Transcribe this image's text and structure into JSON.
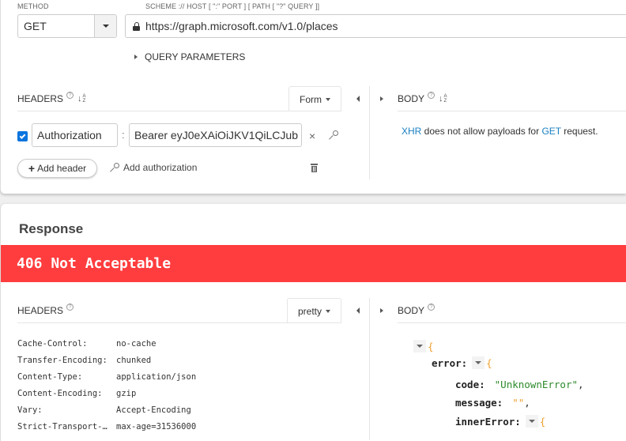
{
  "request": {
    "method_label": "METHOD",
    "method_value": "GET",
    "url_label": "SCHEME :// HOST [ \":\" PORT ] [ PATH [ \"?\" QUERY ]]",
    "url_value": "https://graph.microsoft.com/v1.0/places",
    "query_parameters_label": "QUERY PARAMETERS",
    "headers": {
      "title": "HEADERS",
      "help": "?",
      "mode": "Form",
      "rows": [
        {
          "enabled": true,
          "name": "Authorization",
          "value": "Bearer eyJ0eXAiOiJKV1QiLCJub"
        }
      ],
      "add_header_label": "Add header",
      "add_authorization_label": "Add authorization"
    },
    "body": {
      "title": "BODY",
      "help": "?",
      "message_link1": "XHR",
      "message_mid": " does not allow payloads for ",
      "message_link2": "GET",
      "message_end": " request."
    }
  },
  "response": {
    "title": "Response",
    "status": "406 Not Acceptable",
    "status_color": "#ff3d3e",
    "headers": {
      "title": "HEADERS",
      "help": "?",
      "mode": "pretty",
      "rows": [
        {
          "key": "Cache-Control:",
          "value": "no-cache"
        },
        {
          "key": "Transfer-Encoding:",
          "value": "chunked"
        },
        {
          "key": "Content-Type:",
          "value": "application/json"
        },
        {
          "key": "Content-Encoding:",
          "value": "gzip"
        },
        {
          "key": "Vary:",
          "value": "Accept-Encoding"
        },
        {
          "key": "Strict-Transport-…",
          "value": "max-age=31536000"
        }
      ]
    },
    "body": {
      "title": "BODY",
      "help": "?",
      "json": {
        "open_brace": "{",
        "error_key": "error:",
        "code_key": "code:",
        "code_value": "\"UnknownError\"",
        "message_key": "message:",
        "message_value": "\"\"",
        "inner_error_key": "innerError:",
        "comma": ","
      }
    }
  }
}
